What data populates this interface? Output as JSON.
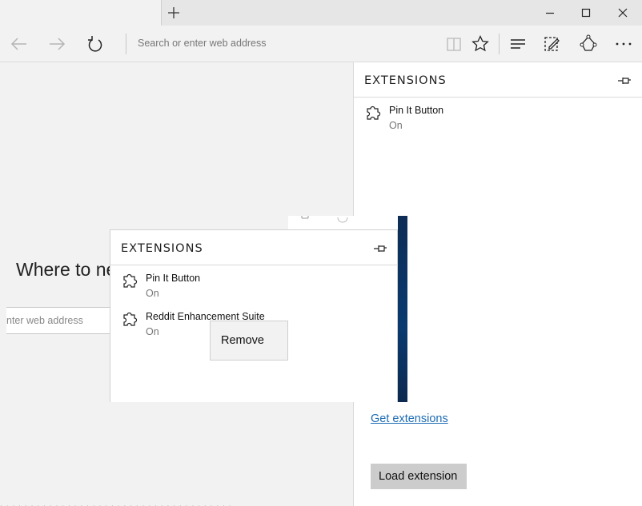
{
  "address_bar": {
    "placeholder": "Search or enter web address"
  },
  "page": {
    "headline": "Where to ne",
    "search_fragment": "nter web address"
  },
  "extensions_pane": {
    "title": "EXTENSIONS",
    "items": [
      {
        "name": "Pin It Button",
        "status": "On"
      }
    ],
    "get_extensions_link": "Get extensions",
    "load_extension_button": "Load extension"
  },
  "extensions_popup": {
    "title": "EXTENSIONS",
    "items": [
      {
        "name": "Pin It Button",
        "status": "On"
      },
      {
        "name": "Reddit Enhancement Suite",
        "status": "On"
      }
    ]
  },
  "context_menu": {
    "remove": "Remove"
  },
  "icons": {
    "new_tab": "plus-icon",
    "minimize": "minimize-icon",
    "maximize": "maximize-icon",
    "close": "close-icon",
    "back": "arrow-left-icon",
    "forward": "arrow-right-icon",
    "refresh": "refresh-icon",
    "reading_view": "book-icon",
    "favorite": "star-icon",
    "hub": "hub-icon",
    "web_note": "pen-note-icon",
    "share": "share-icon",
    "more": "ellipsis-icon",
    "pin": "pin-icon",
    "extension": "puzzle-piece-icon"
  },
  "colors": {
    "link": "#1d6cb4",
    "chrome": "#f2f2f2",
    "button": "#cccccc"
  }
}
